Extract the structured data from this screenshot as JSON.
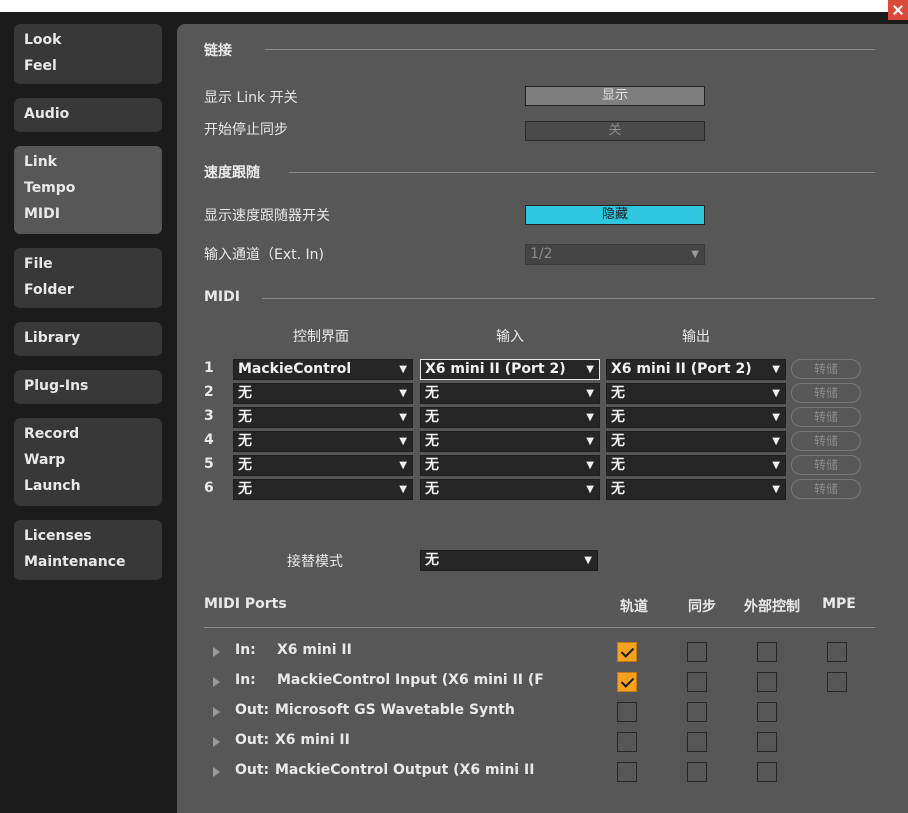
{
  "sidebar": {
    "tabs": [
      {
        "lines": [
          "Look",
          "Feel"
        ]
      },
      {
        "lines": [
          "Audio"
        ]
      },
      {
        "lines": [
          "Link",
          "Tempo",
          "MIDI"
        ]
      },
      {
        "lines": [
          "File",
          "Folder"
        ]
      },
      {
        "lines": [
          "Library"
        ]
      },
      {
        "lines": [
          "Plug-Ins"
        ]
      },
      {
        "lines": [
          "Record",
          "Warp",
          "Launch"
        ]
      },
      {
        "lines": [
          "Licenses",
          "Maintenance"
        ]
      }
    ],
    "active_tab": "Link Tempo MIDI"
  },
  "link": {
    "heading": "链接",
    "show_switch_label": "显示 Link 开关",
    "show_switch_value": "显示",
    "start_stop_label": "开始停止同步",
    "start_stop_value": "关"
  },
  "tempo_follow": {
    "heading": "速度跟随",
    "show_switch_label": "显示速度跟随器开关",
    "show_switch_value": "隐藏",
    "input_channel_label": "输入通道（Ext. In)",
    "input_channel_value": "1/2"
  },
  "midi": {
    "heading": "MIDI",
    "col_control_surface": "控制界面",
    "col_input": "输入",
    "col_output": "输出",
    "dump_label": "转储",
    "rows": [
      {
        "num": "1",
        "surface": "MackieControl",
        "input": "X6 mini II (Port 2)",
        "output": "X6 mini II (Port 2)"
      },
      {
        "num": "2",
        "surface": "无",
        "input": "无",
        "output": "无"
      },
      {
        "num": "3",
        "surface": "无",
        "input": "无",
        "output": "无"
      },
      {
        "num": "4",
        "surface": "无",
        "input": "无",
        "output": "无"
      },
      {
        "num": "5",
        "surface": "无",
        "input": "无",
        "output": "无"
      },
      {
        "num": "6",
        "surface": "无",
        "input": "无",
        "output": "无"
      }
    ],
    "takeover_label": "接替模式",
    "takeover_value": "无"
  },
  "midi_ports": {
    "heading": "MIDI Ports",
    "col_track": "轨道",
    "col_sync": "同步",
    "col_remote": "外部控制",
    "col_mpe": "MPE",
    "ports": [
      {
        "dir": "In:",
        "name": "X6 mini II",
        "track": true,
        "sync": false,
        "remote": false,
        "mpe": false
      },
      {
        "dir": "In:",
        "name": "MackieControl Input (X6 mini II (F",
        "track": true,
        "sync": false,
        "remote": false,
        "mpe": false
      },
      {
        "dir": "Out:",
        "name": "Microsoft GS Wavetable Synth",
        "track": false,
        "sync": false,
        "remote": false
      },
      {
        "dir": "Out:",
        "name": "X6 mini II",
        "track": false,
        "sync": false,
        "remote": false
      },
      {
        "dir": "Out:",
        "name": "MackieControl Output (X6 mini II",
        "track": false,
        "sync": false,
        "remote": false
      }
    ]
  },
  "colors": {
    "accent_cyan": "#2fc6e0",
    "check_orange": "#f5a21e",
    "panel": "#575757",
    "sidebar_bg": "#1b1b1b"
  }
}
